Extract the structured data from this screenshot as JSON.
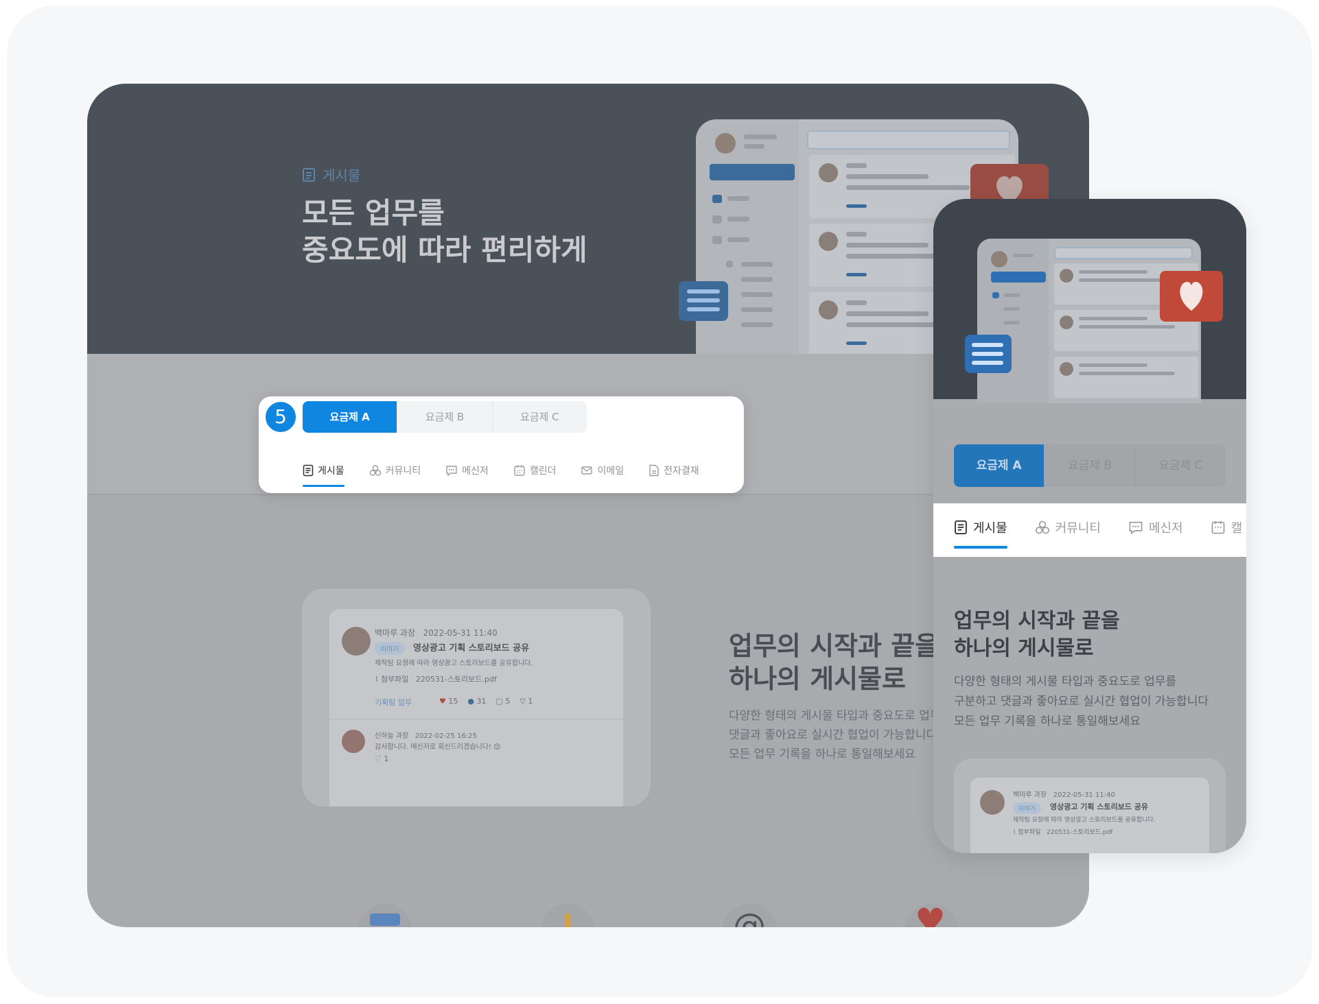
{
  "hero": {
    "tag_label": "게시물",
    "title_line1": "모든 업무를",
    "title_line2": "중요도에 따라 편리하게"
  },
  "step_badge": "5",
  "plans": [
    "요금제 A",
    "요금제 B",
    "요금제 C"
  ],
  "active_plan": 0,
  "tabs": [
    {
      "label": "게시물",
      "icon": "document-icon"
    },
    {
      "label": "커뮤니티",
      "icon": "community-icon"
    },
    {
      "label": "메신저",
      "icon": "chat-icon"
    },
    {
      "label": "캘린더",
      "icon": "calendar-icon"
    },
    {
      "label": "이메일",
      "icon": "mail-icon"
    },
    {
      "label": "전자결재",
      "icon": "approval-icon"
    }
  ],
  "mobile_tabs_visible": [
    {
      "label": "게시물",
      "icon": "document-icon"
    },
    {
      "label": "커뮤니티",
      "icon": "community-icon"
    },
    {
      "label": "메신저",
      "icon": "chat-icon"
    },
    {
      "label": "캘",
      "icon": "calendar-icon"
    }
  ],
  "section": {
    "heading_line1": "업무의 시작과 끝을",
    "heading_line2": "하나의 게시물로",
    "desc_line1": "다양한 형태의 게시물 타입과 중요도로 업무를",
    "desc_line2": "구분하고 댓글과 좋아요로 실시간 협업이 가능합니다",
    "desc_line3": "모든 업무 기록을 하나로 통일해보세요",
    "desk_desc_line1": "다양한 형태의 게시물 타입과 중요도로 업무를",
    "desk_desc_line2": "댓글과 좋아요로 실시간 협업이 가능합니다",
    "desk_desc_line3": "모든 업무 기록을 하나로 통일해보세요"
  },
  "post": {
    "author": "백마루 과장",
    "date": "2022-05-31 11:40",
    "category": "이야기",
    "title": "영상광고 기획 스토리보드 공유",
    "body": "제작팀 요청에 따라 영상광고 스토리보드를 공유합니다.",
    "attachment_label": "첨부파일",
    "attachment_name": "220531-스토리보드.pdf",
    "board": "기획팀 업무",
    "likes": "15",
    "views": "31",
    "comments": "5",
    "shares": "1"
  },
  "comment": {
    "author": "신하늘 과장",
    "date": "2022-02-25 16:25",
    "text": "감사합니다. 메신저로 회신드리겠습니다! 😊",
    "likes": "1"
  },
  "colors": {
    "accent": "#0f86e0",
    "hero_bg": "#4b5158",
    "heart": "#c0493a"
  }
}
